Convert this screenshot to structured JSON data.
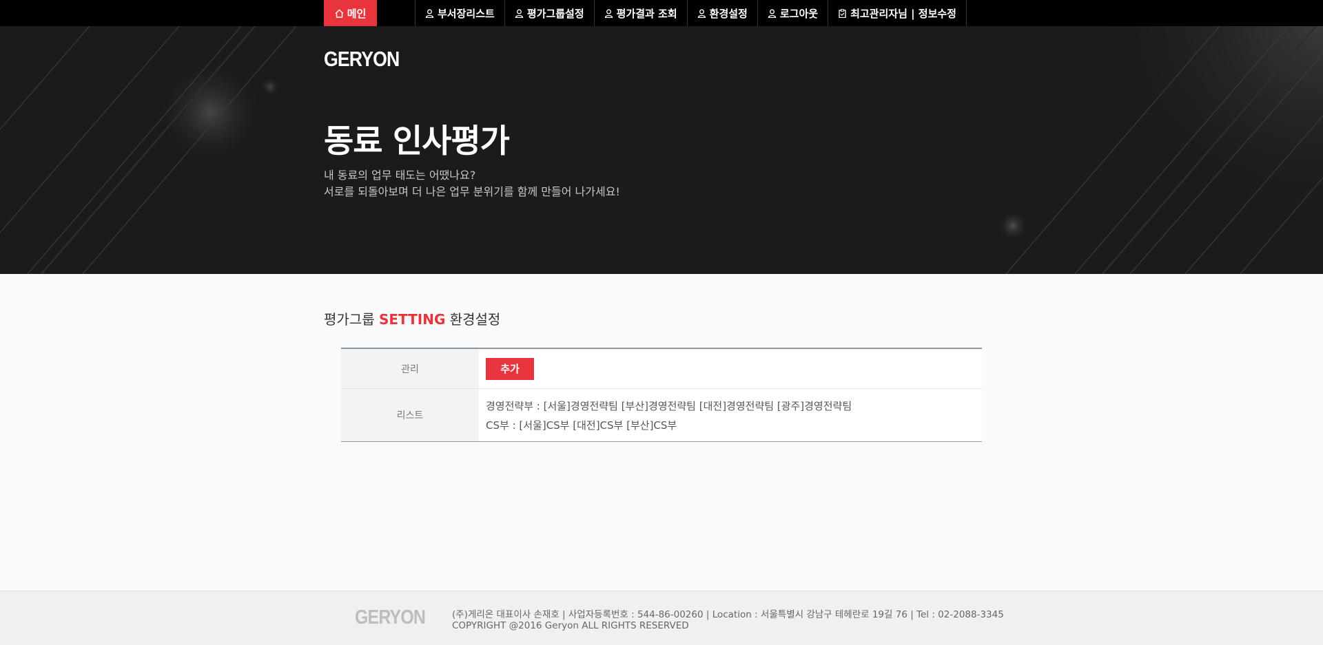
{
  "nav": {
    "home_label": "메인",
    "items": [
      {
        "label": "부서장리스트",
        "icon": "user-icon"
      },
      {
        "label": "평가그룹설정",
        "icon": "user-icon"
      },
      {
        "label": "평가결과 조회",
        "icon": "user-icon"
      },
      {
        "label": "환경설정",
        "icon": "user-icon"
      },
      {
        "label": "로그아웃",
        "icon": "user-icon"
      },
      {
        "label": "최고관리자님 | 정보수정",
        "icon": "clipboard-icon"
      }
    ]
  },
  "hero": {
    "logo": "GERYON",
    "title": "동료 인사평가",
    "subtitle_line1": "내 동료의 업무 태도는 어땠나요?",
    "subtitle_line2": "서로를 되돌아보며 더 나은 업무 분위기를 함께 만들어 나가세요!"
  },
  "section": {
    "title_prefix": "평가그룹 ",
    "title_accent": "SETTING",
    "title_suffix": " 환경설정"
  },
  "table": {
    "manage_label": "관리",
    "add_button": "추가",
    "list_label": "리스트",
    "list_line1": "경영전략부 : [서울]경영전략팀 [부산]경영전략팀 [대전]경영전략팀 [광주]경영전략팀",
    "list_line2": "CS부 : [서울]CS부 [대전]CS부 [부산]CS부"
  },
  "footer": {
    "logo": "GERYON",
    "info_line1": "(주)게리온 대표이사 손재호 | 사업자등록번호 : 544-86-00260 | Location : 서울특별시 강남구 테헤란로 19길 76 | Tel : 02-2088-3345",
    "info_line2": "COPYRIGHT @2016 Geryon ALL RIGHTS RESERVED"
  },
  "colors": {
    "accent": "#e8343c",
    "nav_bg": "#000000",
    "hero_bg": "#1d1d1d"
  }
}
